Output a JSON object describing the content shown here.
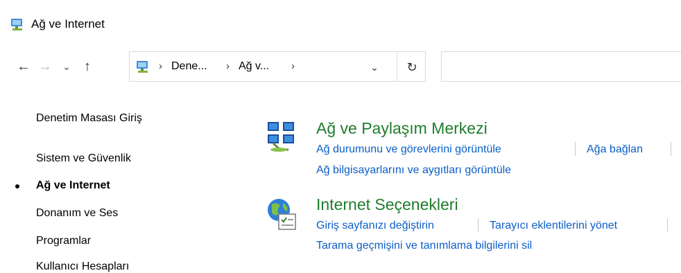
{
  "window": {
    "title": "Ağ ve Internet"
  },
  "nav": {
    "back_icon": "back-arrow-icon",
    "forward_icon": "forward-arrow-icon",
    "recent_icon": "chevron-down-icon",
    "up_icon": "up-arrow-icon"
  },
  "address": {
    "crumbs": [
      "Dene...",
      "Ağ v..."
    ],
    "dropdown_icon": "chevron-down-icon",
    "refresh_icon": "refresh-icon"
  },
  "search": {
    "placeholder": ""
  },
  "sidebar": {
    "items": [
      {
        "label": "Denetim Masası Giriş"
      },
      {
        "label": "Sistem ve Güvenlik"
      },
      {
        "label": "Ağ ve Internet",
        "active": true
      },
      {
        "label": "Donanım ve Ses"
      },
      {
        "label": "Programlar"
      },
      {
        "label": "Kullanıcı Hesapları"
      }
    ]
  },
  "categories": [
    {
      "title": "Ağ ve Paylaşım Merkezi",
      "icon": "network-sharing-center-icon",
      "links": [
        "Ağ durumunu ve görevlerini görüntüle",
        "Ağa bağlan",
        "Ağ bilgisayarlarını ve aygıtları görüntüle"
      ]
    },
    {
      "title": "Internet Seçenekleri",
      "icon": "internet-options-icon",
      "links": [
        "Giriş sayfanızı değiştirin",
        "Tarayıcı eklentilerini yönet",
        "Tarama geçmişini ve tanımlama bilgilerini sil"
      ]
    }
  ],
  "colors": {
    "category_title": "#1e7d2c",
    "link": "#0c5ec7"
  }
}
